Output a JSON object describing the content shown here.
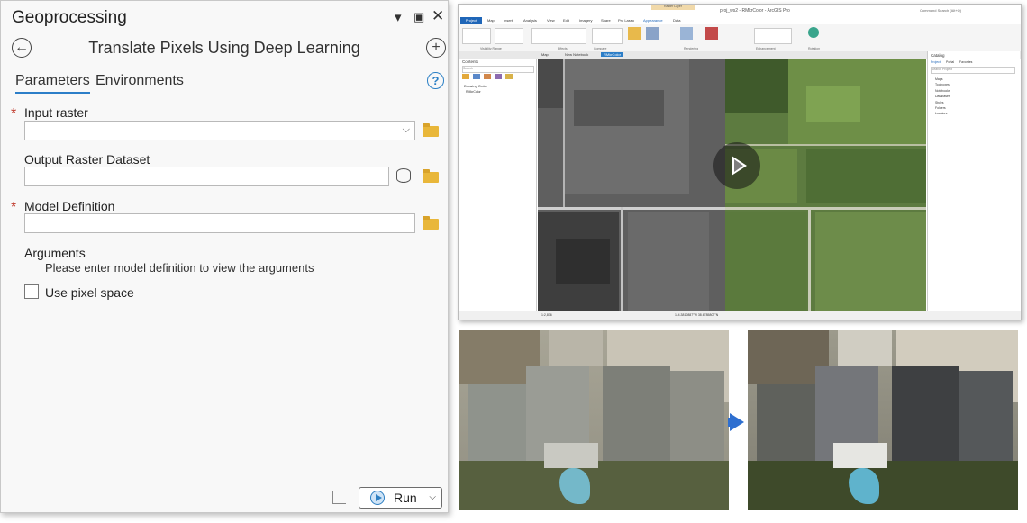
{
  "gp": {
    "title": "Geoprocessing",
    "tool_title": "Translate Pixels Using Deep Learning",
    "tabs": [
      "Parameters",
      "Environments"
    ],
    "params": {
      "input_raster": "Input raster",
      "output_raster": "Output Raster Dataset",
      "model_definition": "Model Definition",
      "arguments": "Arguments",
      "arguments_hint": "Please enter model definition to view the arguments",
      "use_pixel_space": "Use pixel space"
    },
    "run_label": "Run",
    "colors": {
      "accent": "#2c7ec8",
      "required": "#c0392b"
    }
  },
  "app": {
    "window_title": "proj_ws2 - RMkrColor - ArcGIS Pro",
    "context_tab": "Raster Layer",
    "search": "Command Search (Alt+Q)",
    "ribbon_tabs": [
      "Project",
      "Map",
      "Insert",
      "Analysis",
      "View",
      "Edit",
      "Imagery",
      "Share",
      "Pro Lasso",
      "Appearance",
      "Data"
    ],
    "ribbon_groups": [
      "Visibility Range",
      "Effects",
      "Compare",
      "Rendering",
      "Enhancement",
      "Rotation"
    ],
    "view_tabs": [
      "Map",
      "New Notebook",
      "RMkrColor"
    ],
    "contents_title": "Contents",
    "contents_search": "Search",
    "drawing_order": "Drawing Order",
    "contents_layer": "RMkrColor",
    "catalog_title": "Catalog",
    "catalog_tabs": [
      "Project",
      "Portal",
      "Favorites"
    ],
    "catalog_search": "Search Project",
    "catalog_items": [
      "Maps",
      "Toolboxes",
      "Notebooks",
      "Databases",
      "Styles",
      "Folders",
      "Locators"
    ],
    "scale": "1:2,876",
    "coords": "114.3810887°W 38.6785807°N"
  }
}
